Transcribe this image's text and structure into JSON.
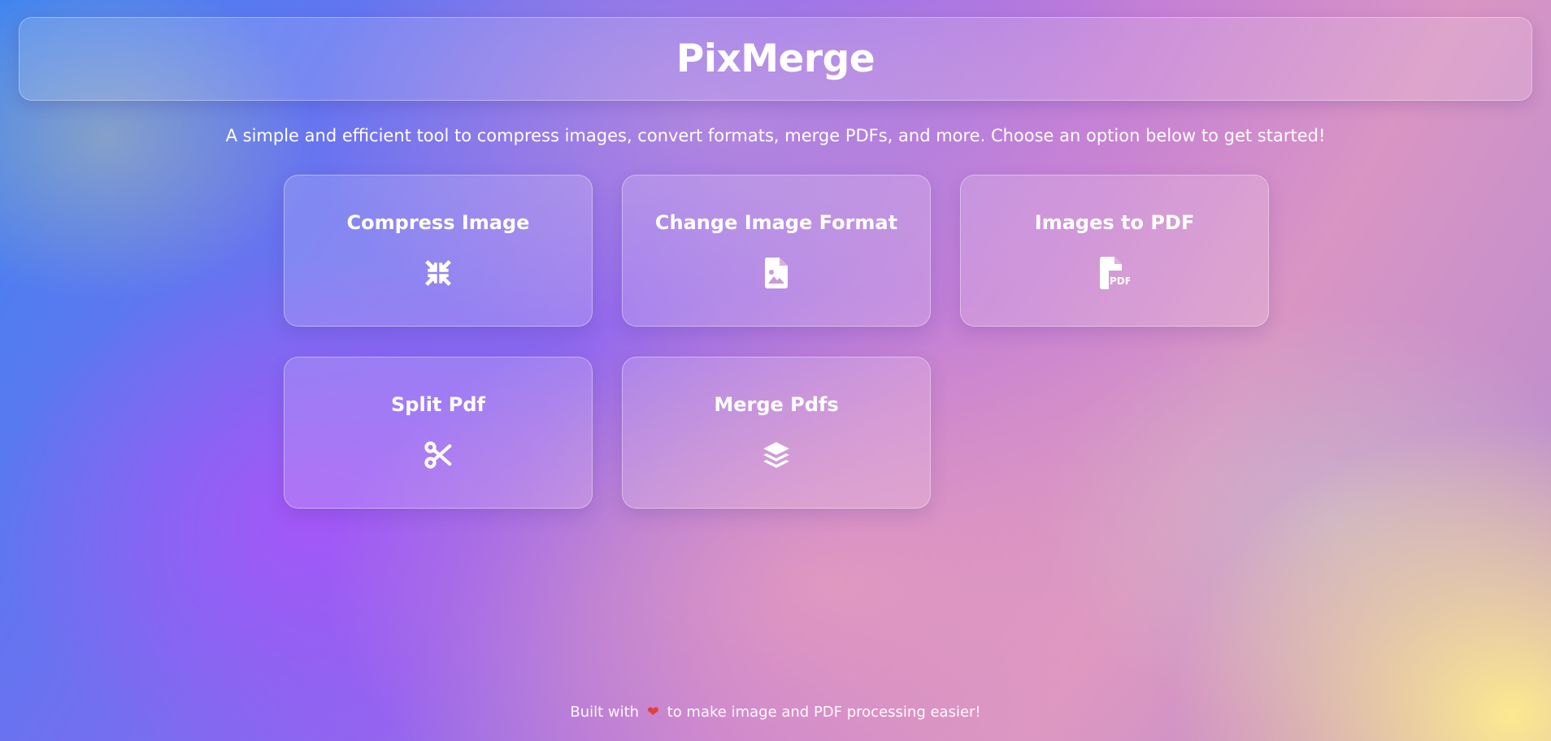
{
  "header": {
    "title": "PixMerge"
  },
  "intro": {
    "text": "A simple and efficient tool to compress images, convert formats, merge PDFs, and more. Choose an option below to get started!"
  },
  "tools": [
    {
      "label": "Compress Image",
      "icon": "compress-icon"
    },
    {
      "label": "Change Image Format",
      "icon": "image-file-icon"
    },
    {
      "label": "Images to PDF",
      "icon": "pdf-file-icon"
    },
    {
      "label": "Split Pdf",
      "icon": "scissors-icon"
    },
    {
      "label": "Merge Pdfs",
      "icon": "layers-icon"
    }
  ],
  "footer": {
    "before": "Built with",
    "heart": "❤",
    "after": "to make image and PDF processing easier!"
  },
  "colors": {
    "heart": "#e0403c",
    "text": "#ffffff"
  }
}
